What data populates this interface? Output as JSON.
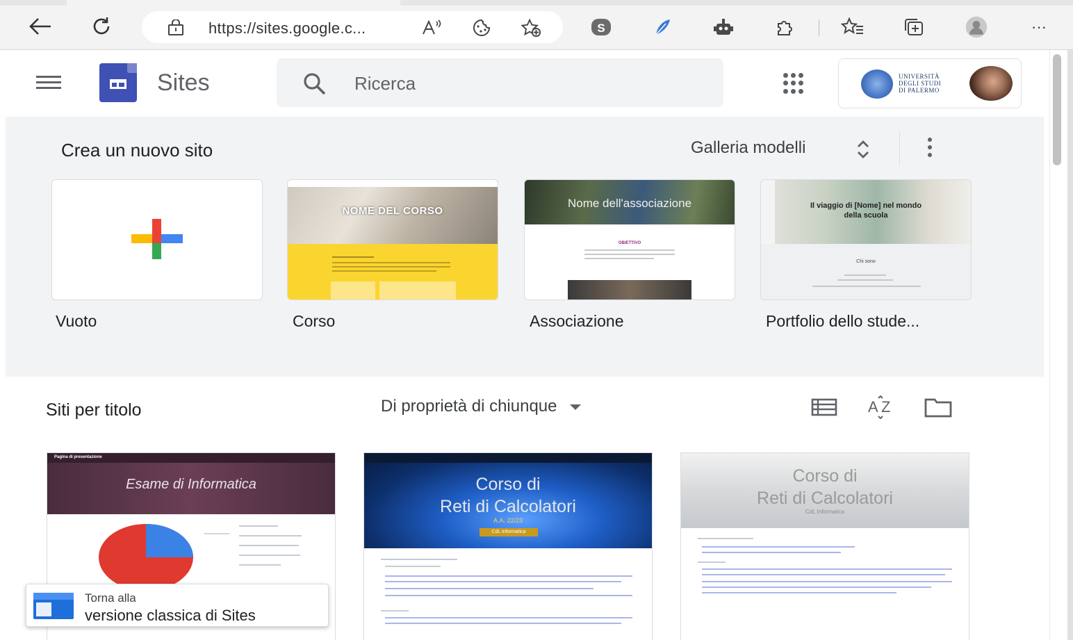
{
  "browser": {
    "url": "https://sites.google.c...",
    "more_label": "···"
  },
  "header": {
    "app_name": "Sites",
    "search_placeholder": "Ricerca",
    "university_text": [
      "UNIVERSITÀ",
      "DEGLI STUDI",
      "DI PALERMO"
    ]
  },
  "gallery": {
    "title": "Crea un nuovo sito",
    "toggle_label": "Galleria modelli",
    "templates": [
      {
        "label": "Vuoto"
      },
      {
        "label": "Corso",
        "heading": "NOME DEL CORSO"
      },
      {
        "label": "Associazione",
        "heading": "Nome dell'associazione",
        "sub": "OBIETTIVO"
      },
      {
        "label": "Portfolio dello stude...",
        "heading": "Il viaggio di [Nome] nel mondo della scuola",
        "sub": "Chi sono"
      }
    ]
  },
  "sites": {
    "title": "Siti per titolo",
    "owner_filter": "Di proprietà di chiunque",
    "cards": [
      {
        "title": "Esame di Informatica",
        "header_text": "Pagina di presentazione"
      },
      {
        "title_line1": "Corso di",
        "title_line2": "Reti di Calcolatori",
        "subtitle": "A.A. 22/23",
        "badge": "CdL Informatica"
      },
      {
        "title_line1": "Corso di",
        "title_line2": "Reti di Calcolatori",
        "subtitle": "CdL Informatica"
      }
    ]
  },
  "snackbar": {
    "line1": "Torna alla",
    "line2": "versione classica di Sites"
  },
  "colors": {
    "sites_brand": "#3f51b5",
    "gallery_bg": "#f1f3f4",
    "corso_yellow": "#fbd52f",
    "pie_red": "#e0392f",
    "pie_blue": "#3b82e6"
  }
}
